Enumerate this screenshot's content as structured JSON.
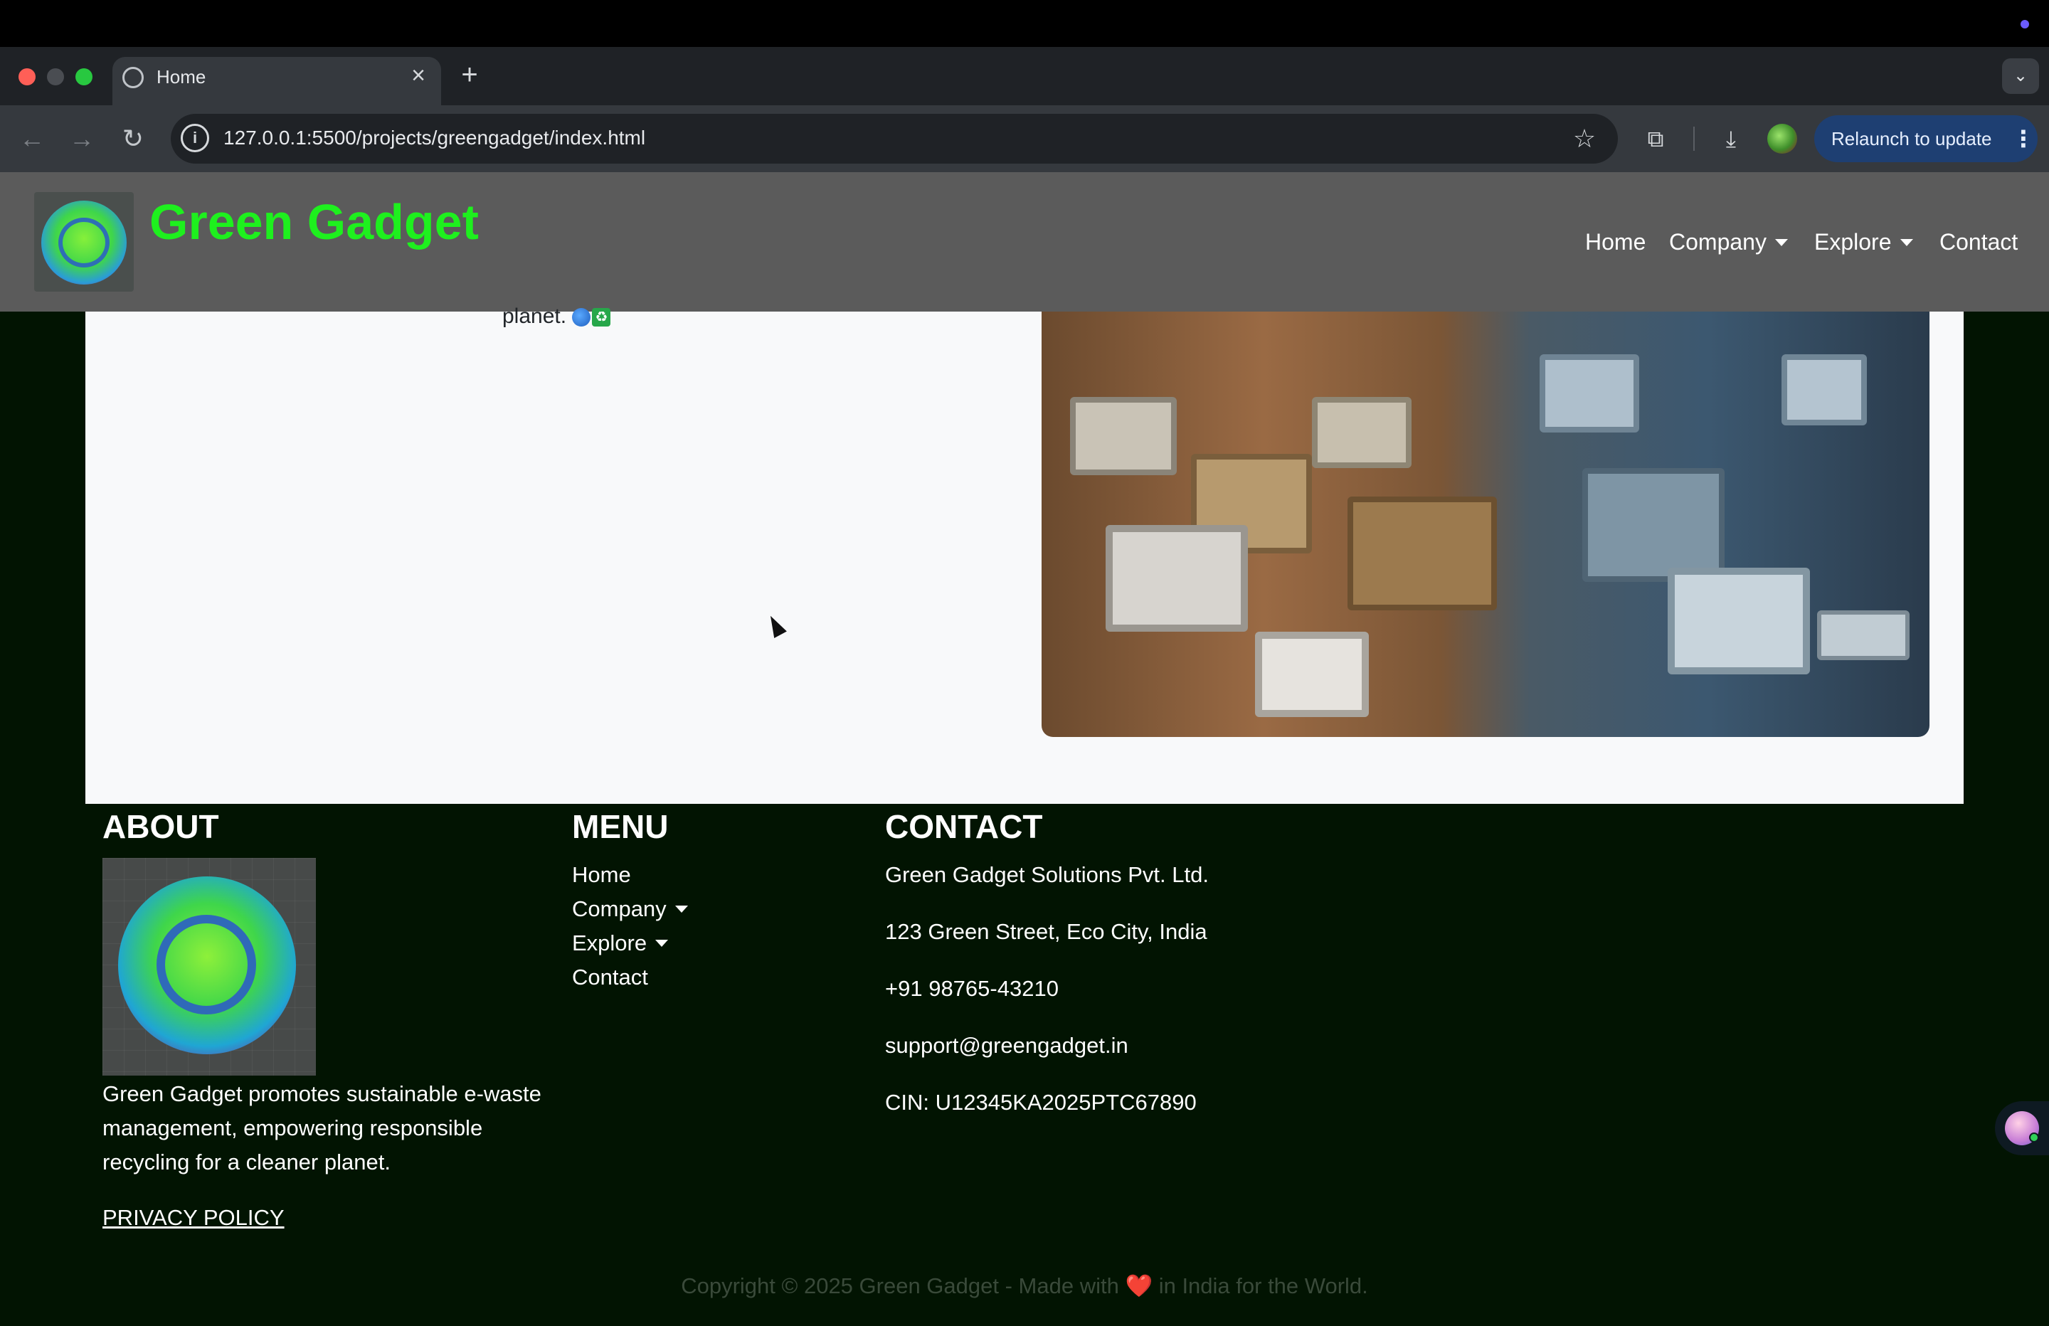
{
  "browser": {
    "tab_title": "Home",
    "tab_close": "×",
    "new_tab": "+",
    "url": "127.0.0.1:5500/projects/greengadget/index.html",
    "relaunch_label": "Relaunch to update",
    "icons": [
      "back-icon",
      "forward-icon",
      "reload-icon",
      "site-info-icon",
      "bookmark-star-icon",
      "extensions-icon",
      "downloads-icon",
      "profile-avatar",
      "menu-dots-icon",
      "tab-list-chevron-icon"
    ]
  },
  "site": {
    "brand": "Green Gadget",
    "nav": {
      "home": "Home",
      "company": "Company",
      "explore": "Explore",
      "contact": "Contact"
    },
    "hero_text_tail": "planet."
  },
  "footer": {
    "about_heading": "ABOUT",
    "about_text": "Green Gadget promotes sustainable e-waste management, empowering responsible recycling for a cleaner planet.",
    "privacy": "PRIVACY POLICY",
    "menu_heading": "MENU",
    "menu": {
      "home": "Home",
      "company": "Company",
      "explore": "Explore",
      "contact": "Contact"
    },
    "contact_heading": "CONTACT",
    "contact": {
      "company": "Green Gadget Solutions Pvt. Ltd.",
      "address": "123 Green Street, Eco City, India",
      "phone": "+91 98765-43210",
      "email": "support@greengadget.in",
      "cin": "CIN: U12345KA2025PTC67890"
    },
    "copyright_before": "Copyright © 2025 Green Gadget - Made with",
    "copyright_heart": "❤️",
    "copyright_after": "in India for the World."
  },
  "colors": {
    "brand_green": "#1ef01e",
    "navbar_bg": "#5b5b5b",
    "footer_bg": "#021402",
    "relaunch_bg": "#1e3f72"
  }
}
